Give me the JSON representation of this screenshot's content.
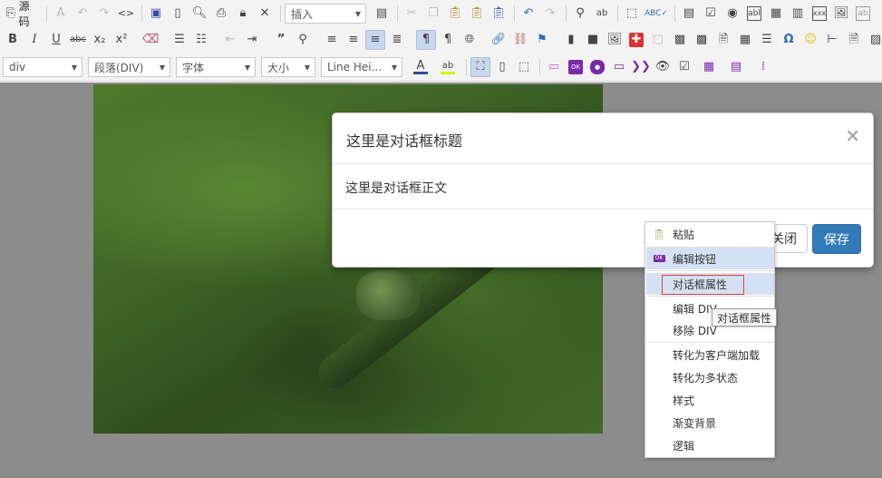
{
  "toolbar": {
    "source_label": "源码",
    "insert_combo": "插入",
    "element_combo": "div",
    "paragraph_combo": "段落(DIV)",
    "font_combo": "字体",
    "size_combo": "大小",
    "lineheight_combo": "Line Hei...",
    "icons_row1": [
      "source-icon",
      "select-all-icon",
      "undo-format-icon",
      "redo-format-icon",
      "code-icon",
      "save-icon",
      "new-doc-icon",
      "preview-icon",
      "print-icon",
      "lock-icon",
      "clear-icon",
      "template-icon",
      "cut-icon",
      "copy-icon",
      "paste-icon",
      "paste-text-icon",
      "paste-word-icon",
      "undo-icon",
      "redo-icon",
      "find-icon",
      "replace-icon",
      "select-icon",
      "spellcheck-icon",
      "form-icon",
      "checkbox-icon",
      "radio-icon",
      "textfield-icon",
      "textarea-icon",
      "select-field-icon",
      "button-field-icon",
      "image-button-icon",
      "hidden-field-icon"
    ],
    "icons_row2": [
      "bold-icon",
      "italic-icon",
      "underline-icon",
      "strike-icon",
      "subscript-icon",
      "superscript-icon",
      "remove-format-icon",
      "numbered-list-icon",
      "bulleted-list-icon",
      "outdent-icon",
      "indent-icon",
      "blockquote-icon",
      "find2-icon",
      "align-left-icon",
      "align-center-icon",
      "align-right-icon",
      "justify-icon",
      "ltr-icon",
      "rtl-icon",
      "language-icon",
      "link-icon",
      "unlink-icon",
      "anchor-icon",
      "chart-icon",
      "flash-icon",
      "image-icon",
      "special-icon",
      "iframe-icon",
      "media-icon",
      "media2-icon",
      "file-icon",
      "table-icon",
      "list-icon",
      "omega-icon",
      "smiley-icon",
      "pagebreak-icon",
      "fileinfo-icon",
      "imagemap-icon"
    ],
    "icons_row3": [
      "text-color-icon",
      "bg-color-icon",
      "maximize-icon",
      "showblocks-icon",
      "blocks-icon",
      "div-icon",
      "button-comp-icon",
      "badge-icon",
      "label-icon",
      "pill-icon",
      "glyph-icon",
      "view-icon",
      "check-icon",
      "grid-icon",
      "table2-icon",
      "misc-icon"
    ]
  },
  "modal": {
    "title": "这里是对话框标题",
    "close_glyph": "×",
    "body": "这里是对话框正文",
    "close_button": "关闭",
    "save_button": "保存"
  },
  "context_menu": {
    "items": [
      {
        "label": "粘贴",
        "icon": "paste-icon"
      },
      {
        "label": "编辑按钮",
        "icon": "button-icon"
      },
      {
        "label": "对话框属性",
        "icon": ""
      },
      {
        "label": "编辑 DIV",
        "icon": ""
      },
      {
        "label": "移除 DIV",
        "icon": ""
      },
      {
        "label": "转化为客户端加载",
        "icon": ""
      },
      {
        "label": "转化为多状态",
        "icon": ""
      },
      {
        "label": "样式",
        "icon": ""
      },
      {
        "label": "渐变背景",
        "icon": ""
      },
      {
        "label": "逻辑",
        "icon": ""
      }
    ]
  },
  "tooltip": "对话框属性",
  "colors": {
    "primary": "#337ab7",
    "highlight": "#d4e1f4",
    "focus_border": "#e23b3b",
    "overlay": "#8c8c8c"
  }
}
